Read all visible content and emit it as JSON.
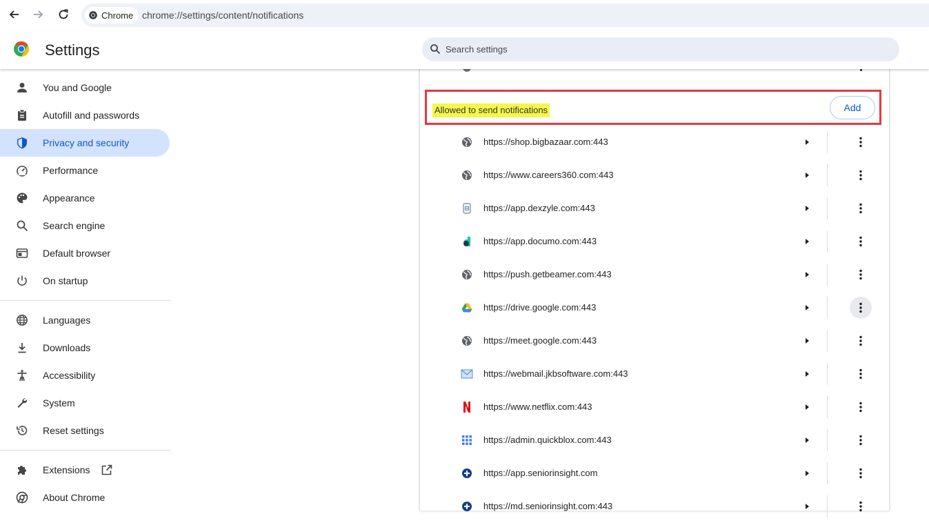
{
  "browser": {
    "chip_label": "Chrome",
    "url": "chrome://settings/content/notifications"
  },
  "header": {
    "title": "Settings",
    "search_placeholder": "Search settings"
  },
  "sidebar": {
    "items": [
      {
        "label": "You and Google",
        "icon": "person-icon"
      },
      {
        "label": "Autofill and passwords",
        "icon": "clipboard-icon"
      },
      {
        "label": "Privacy and security",
        "icon": "shield-icon",
        "active": true
      },
      {
        "label": "Performance",
        "icon": "speedometer-icon"
      },
      {
        "label": "Appearance",
        "icon": "palette-icon"
      },
      {
        "label": "Search engine",
        "icon": "search-icon"
      },
      {
        "label": "Default browser",
        "icon": "browser-window-icon"
      },
      {
        "label": "On startup",
        "icon": "power-icon"
      },
      {
        "label": "Languages",
        "icon": "globe-icon"
      },
      {
        "label": "Downloads",
        "icon": "download-icon"
      },
      {
        "label": "Accessibility",
        "icon": "accessibility-icon"
      },
      {
        "label": "System",
        "icon": "wrench-icon"
      },
      {
        "label": "Reset settings",
        "icon": "reset-history-icon"
      },
      {
        "label": "Extensions",
        "icon": "puzzle-icon"
      },
      {
        "label": "About Chrome",
        "icon": "chrome-logo-icon"
      }
    ]
  },
  "section": {
    "title": "Allowed to send notifications",
    "add_label": "Add"
  },
  "sites": [
    {
      "url": "https://shop.bigbazaar.com:443",
      "favicon": "globe-icon"
    },
    {
      "url": "https://www.careers360.com:443",
      "favicon": "globe-icon"
    },
    {
      "url": "https://app.dexzyle.com:443",
      "favicon": "dexzyle-icon"
    },
    {
      "url": "https://app.documo.com:443",
      "favicon": "documo-icon"
    },
    {
      "url": "https://push.getbeamer.com:443",
      "favicon": "globe-icon"
    },
    {
      "url": "https://drive.google.com:443",
      "favicon": "google-drive-icon"
    },
    {
      "url": "https://meet.google.com:443",
      "favicon": "globe-icon"
    },
    {
      "url": "https://webmail.jkbsoftware.com:443",
      "favicon": "mail-icon"
    },
    {
      "url": "https://www.netflix.com:443",
      "favicon": "netflix-icon"
    },
    {
      "url": "https://admin.quickblox.com:443",
      "favicon": "quickblox-icon"
    },
    {
      "url": "https://app.seniorinsight.com",
      "favicon": "seniorinsight-icon"
    },
    {
      "url": "https://md.seniorinsight.com:443",
      "favicon": "seniorinsight-icon"
    }
  ]
}
